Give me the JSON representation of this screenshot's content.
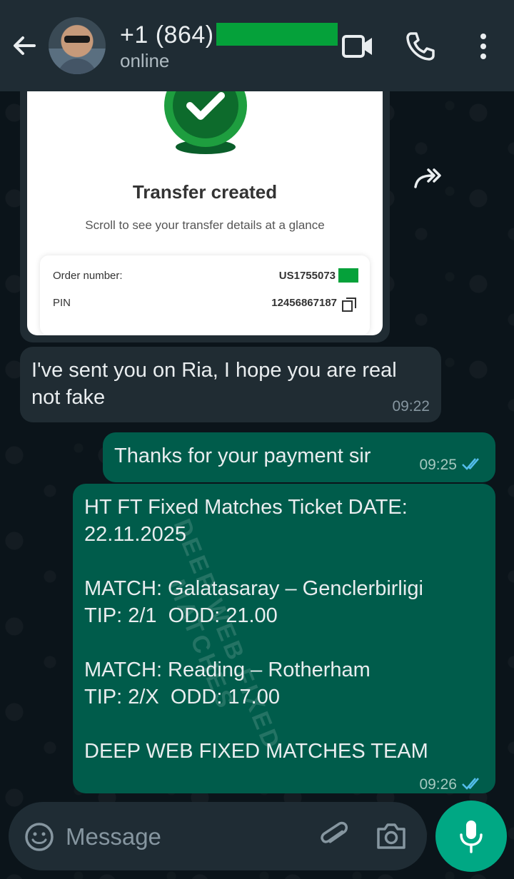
{
  "header": {
    "contact_name": "+1 (864)",
    "status": "online"
  },
  "image_message": {
    "title": "Transfer created",
    "subtitle": "Scroll to see your transfer details at a glance",
    "order_label": "Order number:",
    "order_value": "US1755073",
    "pin_label": "PIN",
    "pin_value": "12456867187"
  },
  "messages": [
    {
      "direction": "in",
      "text": "I've sent you on Ria, I hope you are real\nnot fake",
      "time": "09:22"
    },
    {
      "direction": "out",
      "text": "Thanks for your payment sir",
      "time": "09:25",
      "status": "read"
    },
    {
      "direction": "out",
      "text": "HT FT Fixed Matches Ticket DATE:\n22.11.2025\n\nMATCH: Galatasaray – Genclerbirligi\nTIP: 2/1  ODD: 21.00\n\nMATCH: Reading – Rotherham\nTIP: 2/X  ODD: 17.00\n\nDEEP WEB FIXED MATCHES TEAM",
      "time": "09:26",
      "status": "read"
    }
  ],
  "watermark": "DEEP WEB FIXED MATCHES",
  "input": {
    "placeholder": "Message"
  },
  "icons": {
    "back": "arrow-left-icon",
    "video": "video-call-icon",
    "call": "phone-icon",
    "menu": "more-vert-icon",
    "forward": "forward-icon",
    "emoji": "emoji-icon",
    "attach": "paperclip-icon",
    "camera": "camera-icon",
    "mic": "mic-icon"
  },
  "colors": {
    "header_bg": "#1f2c34",
    "chat_bg": "#0b141a",
    "incoming_bubble": "#202c33",
    "outgoing_bubble": "#005c4b",
    "accent": "#00a884",
    "read_tick": "#53bdeb"
  }
}
